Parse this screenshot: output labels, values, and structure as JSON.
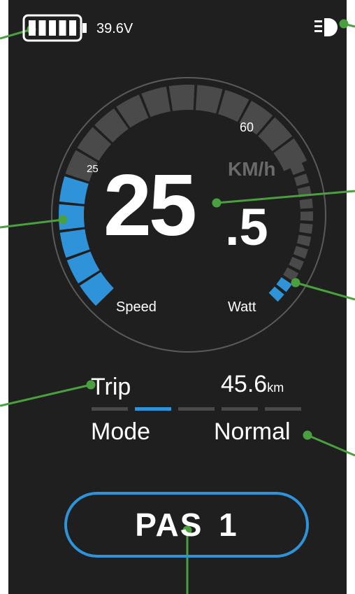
{
  "battery": {
    "voltage": "39.6V",
    "bars_filled": 5,
    "bars_total": 5
  },
  "headlight": {
    "icon": "headlight-icon"
  },
  "speed": {
    "value_int": "25",
    "value_dec": ".5",
    "unit": "KM/h",
    "label": "Speed",
    "scale_ticks": [
      "25",
      "60"
    ],
    "gauge_segments_total": 16,
    "gauge_segments_active": 5
  },
  "power": {
    "label": "Watt",
    "segments_total": 12,
    "segments_active": 2
  },
  "trip": {
    "label": "Trip",
    "value": "45.6",
    "unit": "km"
  },
  "mode": {
    "label": "Mode",
    "value": "Normal",
    "segments_total": 5,
    "active_segment": 2
  },
  "pas": {
    "label": "PAS  1"
  },
  "colors": {
    "accent": "#2f93d9",
    "background": "#1f1f1f",
    "inactive": "#4a4a4a",
    "callout": "#4aa03f"
  }
}
